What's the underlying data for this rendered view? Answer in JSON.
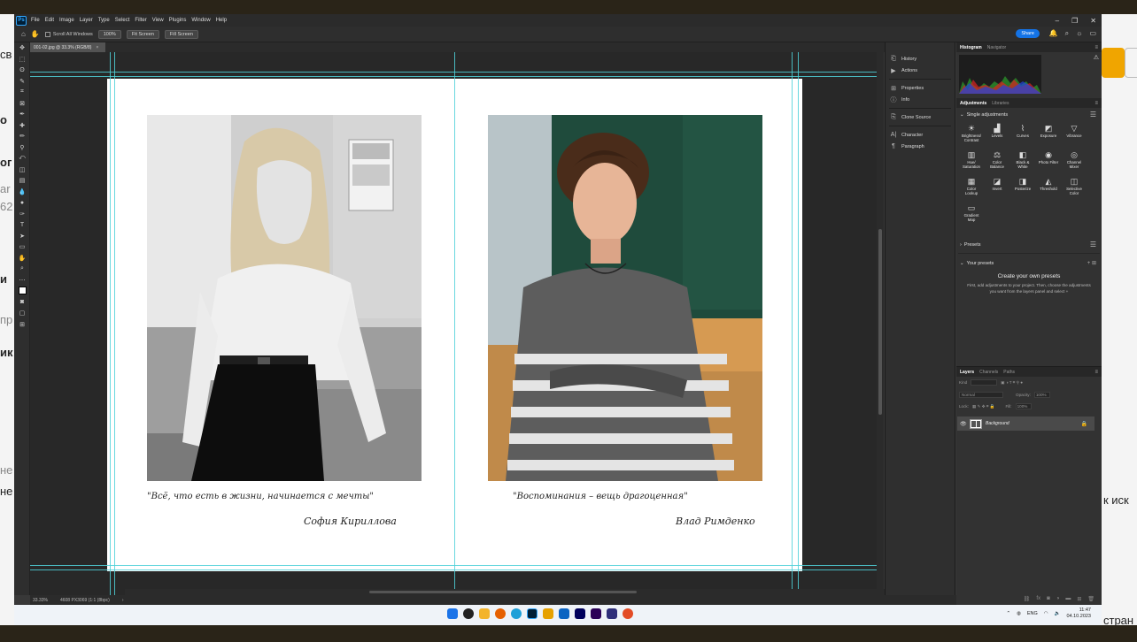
{
  "background_page": {
    "fragments": [
      "св",
      "о",
      "ог",
      "ar",
      "62",
      "и",
      "пр",
      "ик",
      "не",
      "нe",
      "к иск",
      "стран"
    ]
  },
  "app": {
    "logo": "Ps",
    "menu": [
      "File",
      "Edit",
      "Image",
      "Layer",
      "Type",
      "Select",
      "Filter",
      "View",
      "Plugins",
      "Window",
      "Help"
    ],
    "window_controls": [
      "–",
      "❐",
      "✕"
    ]
  },
  "options_bar": {
    "scroll_all_windows": "Scroll All Windows",
    "zoom_100": "100%",
    "fit_screen": "Fit Screen",
    "fill_screen": "Fill Screen",
    "share": "Share"
  },
  "document": {
    "tab_title": "001-02.jpg @ 33.3% (RGB/8)",
    "zoom": "33.33%",
    "doc_info": "4608 PX3069 (1:1 (8bpc)"
  },
  "canvas": {
    "left_quote": "\"Всё, что есть в жизни, начинается с мечты\"",
    "left_name": "София Кириллова",
    "right_quote": "\"Воспоминания – вещь драгоценная\"",
    "right_name": "Влад Римденко"
  },
  "dock": {
    "items": [
      "History",
      "Actions",
      "Properties",
      "Info",
      "Clone Source",
      "Character",
      "Paragraph"
    ]
  },
  "histogram_panel": {
    "tabs": [
      "Histogram",
      "Navigator"
    ]
  },
  "adjustments_panel": {
    "tabs": [
      "Adjustments",
      "Libraries"
    ],
    "single_adjustments": "Single adjustments",
    "items": [
      {
        "label": "Brightness/ Contrast"
      },
      {
        "label": "Levels"
      },
      {
        "label": "Curves"
      },
      {
        "label": "Exposure"
      },
      {
        "label": "Vibrance"
      },
      {
        "label": "Hue/ Saturation"
      },
      {
        "label": "Color Balance"
      },
      {
        "label": "Black & White"
      },
      {
        "label": "Photo Filter"
      },
      {
        "label": "Channel Mixer"
      },
      {
        "label": "Color Lookup"
      },
      {
        "label": "Invert"
      },
      {
        "label": "Posterize"
      },
      {
        "label": "Threshold"
      },
      {
        "label": "Selective Color"
      },
      {
        "label": "Gradient Map"
      }
    ],
    "presets": "Presets",
    "your_presets": "Your presets",
    "create_title": "Create your own presets",
    "create_desc": "First, add adjustments to your project. Then, choose the adjustments you want from the layers panel and select +"
  },
  "layers_panel": {
    "tabs": [
      "Layers",
      "Channels",
      "Paths"
    ],
    "kind": "Kind",
    "blend_mode": "Normal",
    "opacity_label": "Opacity:",
    "opacity": "100%",
    "lock_label": "Lock:",
    "fill_label": "Fill:",
    "fill": "100%",
    "layer_name": "Background"
  },
  "taskbar": {
    "lang": "ENG",
    "time": "11:47",
    "date": "04.10.2023"
  }
}
